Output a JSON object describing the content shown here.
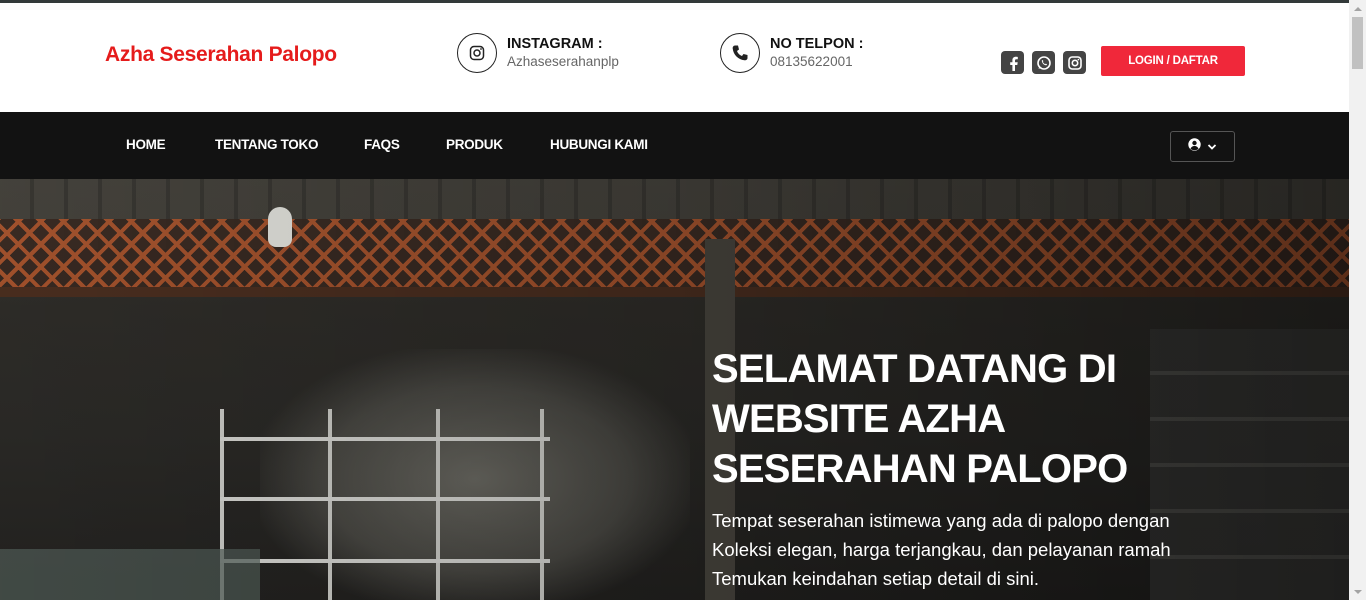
{
  "header": {
    "brand": "Azha Seserahan Palopo",
    "instagram": {
      "title": "INSTAGRAM :",
      "value": "Azhaseserahanplp",
      "icon": "instagram-icon"
    },
    "phone": {
      "title": "NO TELPON :",
      "value": "08135622001",
      "icon": "phone-icon"
    },
    "socials": [
      {
        "icon": "facebook-icon"
      },
      {
        "icon": "whatsapp-icon"
      },
      {
        "icon": "instagram-icon"
      }
    ],
    "login_label": "LOGIN / DAFTAR"
  },
  "nav": {
    "items": [
      {
        "label": "HOME"
      },
      {
        "label": "TENTANG TOKO"
      },
      {
        "label": "FAQS"
      },
      {
        "label": "PRODUK"
      },
      {
        "label": "HUBUNGI KAMI"
      }
    ],
    "user_menu_icon": "user-circle-icon"
  },
  "hero": {
    "title": "SELAMAT DATANG DI WEBSITE AZHA SESERAHAN PALOPO",
    "text_lines": [
      "Tempat seserahan istimewa yang ada di palopo dengan",
      "Koleksi elegan, harga terjangkau, dan pelayanan ramah",
      "Temukan keindahan setiap detail di sini."
    ]
  },
  "colors": {
    "brand": "#e51b1b",
    "login_button": "#f0283a",
    "navbar": "#121212"
  }
}
